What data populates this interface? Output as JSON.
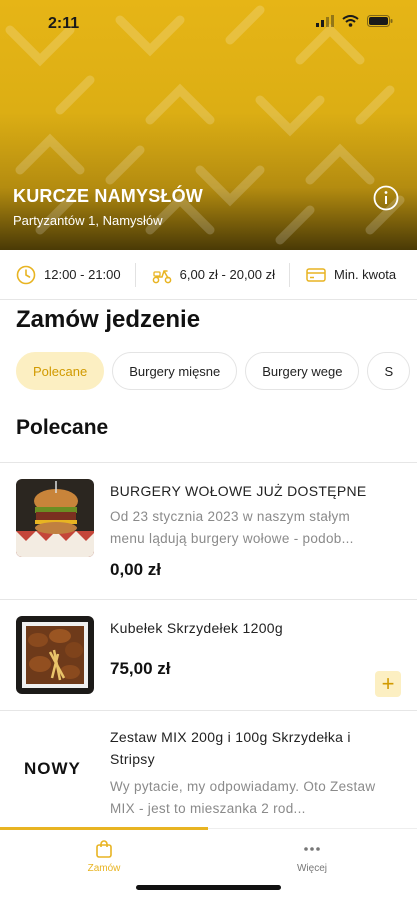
{
  "status_bar": {
    "time": "2:11"
  },
  "restaurant": {
    "name": "KURCZE NAMYSŁÓW",
    "address": "Partyzantów 1, Namysłów"
  },
  "info_row": {
    "hours": "12:00 - 21:00",
    "delivery_fee": "6,00 zł - 20,00 zł",
    "min_amount": "Min. kwota"
  },
  "page_title": "Zamów jedzenie",
  "chips": [
    {
      "label": "Polecane",
      "active": true
    },
    {
      "label": "Burgery mięsne",
      "active": false
    },
    {
      "label": "Burgery wege",
      "active": false
    },
    {
      "label": "S",
      "active": false
    }
  ],
  "category_heading": "Polecane",
  "items": [
    {
      "title": "BURGERY WOŁOWE JUŻ DOSTĘPNE",
      "description": "Od 23 stycznia 2023 w naszym stałym menu lądują burgery wołowe - podob...",
      "price": "0,00 zł",
      "image": "burger-photo"
    },
    {
      "title": "Kubełek Skrzydełek 1200g",
      "description": "",
      "price": "75,00 zł",
      "image": "wings-photo",
      "add": "+"
    },
    {
      "title": "Zestaw MIX 200g i 100g Skrzydełka i Stripsy",
      "description": "Wy pytacie, my odpowiadamy. Oto Zestaw MIX - jest to mieszanka 2 rod...",
      "badge": "NOWY"
    }
  ],
  "bottom_nav": {
    "tabs": [
      {
        "label": "Zamów",
        "icon": "bag-icon",
        "active": true
      },
      {
        "label": "Więcej",
        "icon": "more-dots-icon",
        "active": false
      }
    ]
  },
  "colors": {
    "accent": "#e8b422",
    "accent_soft": "#fcefc2",
    "accent_text": "#d19a00"
  }
}
